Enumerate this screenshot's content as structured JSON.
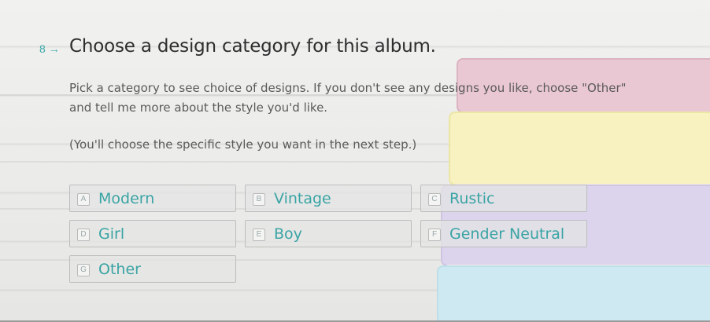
{
  "question": {
    "number": "8",
    "arrow": "→",
    "title": "Choose a design category for this album.",
    "description": "Pick a category to see choice of designs. If you don't see any designs you like, choose \"Other\" and tell me more about the style you'd like.",
    "note": "(You'll choose the specific style you want in the next step.)"
  },
  "choices": [
    {
      "key": "A",
      "label": "Modern"
    },
    {
      "key": "B",
      "label": "Vintage"
    },
    {
      "key": "C",
      "label": "Rustic"
    },
    {
      "key": "D",
      "label": "Girl"
    },
    {
      "key": "E",
      "label": "Boy"
    },
    {
      "key": "F",
      "label": "Gender Neutral"
    },
    {
      "key": "G",
      "label": "Other"
    }
  ],
  "colors": {
    "accent": "#3aa4a4",
    "title": "#2e2e2e",
    "body_text": "#5a5a5a"
  }
}
